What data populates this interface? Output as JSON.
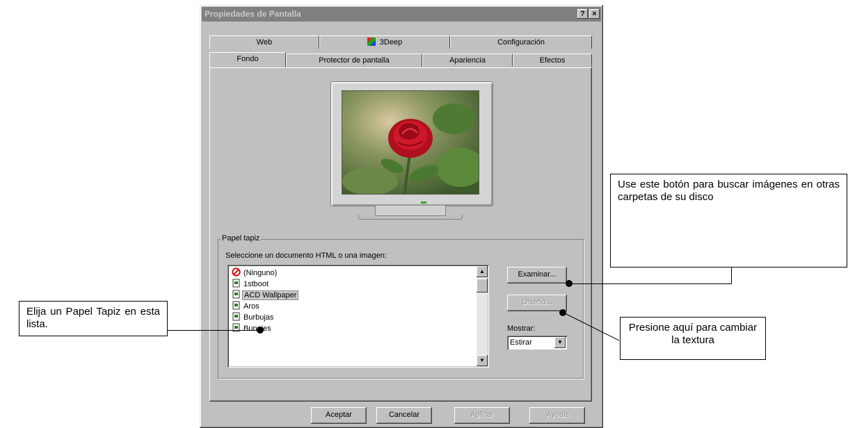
{
  "window": {
    "title": "Propiedades de Pantalla",
    "help_button": "?",
    "close_button": "×"
  },
  "tabs": {
    "row1": [
      "Web",
      "3Deep",
      "Configuración"
    ],
    "row2": [
      "Fondo",
      "Protector de pantalla",
      "Apariencia",
      "Efectos"
    ],
    "active": "Fondo"
  },
  "wallpaper": {
    "group_label": "Papel tapiz",
    "hint": "Seleccione un documento HTML o una imagen:",
    "items": [
      "(Ninguno)",
      "1stboot",
      "ACD Wallpaper",
      "Aros",
      "Burbujas",
      "Bunnies"
    ],
    "selected": "ACD Wallpaper",
    "browse_button": "Examinar...",
    "pattern_button": "Diseño...",
    "display_label": "Mostrar:",
    "display_value": "Estirar"
  },
  "footer": {
    "accept": "Aceptar",
    "cancel": "Cancelar",
    "apply": "Aplicar",
    "help": "Ayuda"
  },
  "callouts": {
    "browse": "Use este botón para buscar imágenes en otras carpetas de su disco",
    "list": "Elija un Papel Tapiz en esta lista.",
    "pattern": "Presione aquí para cambiar la textura"
  },
  "colors": {
    "window_face": "#c0c0c0",
    "titlebar_inactive": "#808080",
    "rose": "#c0182a",
    "foliage": "#4f6c38"
  }
}
